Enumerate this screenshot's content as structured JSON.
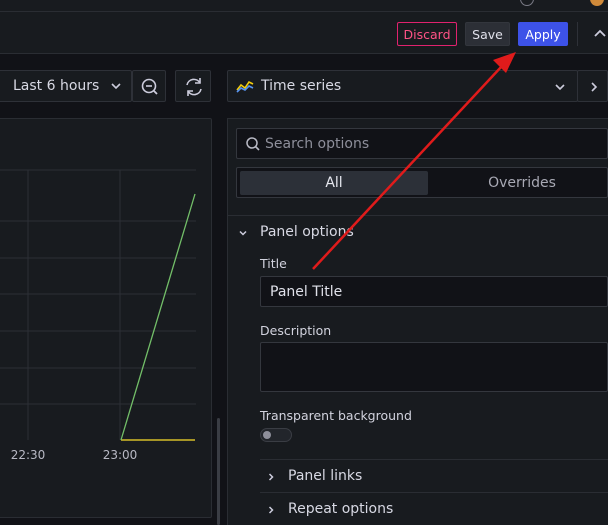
{
  "toolbar": {
    "discard_label": "Discard",
    "save_label": "Save",
    "apply_label": "Apply"
  },
  "time_range": {
    "label": "Last 6 hours"
  },
  "visualization": {
    "selected": "Time series"
  },
  "chart_data": {
    "type": "line",
    "x_tick_labels": [
      "22:30",
      "23:00"
    ],
    "series": [
      {
        "color": "#73bf69",
        "description": "rising line"
      },
      {
        "color": "#fade2a",
        "description": "flat line"
      }
    ]
  },
  "options": {
    "search_placeholder": "Search options",
    "tabs": [
      "All",
      "Overrides"
    ],
    "panel_options": {
      "title": "Panel options",
      "title_label": "Title",
      "title_value": "Panel Title",
      "description_label": "Description",
      "description_value": "",
      "transparent_label": "Transparent background",
      "transparent_on": false
    },
    "collapsed_sections": [
      "Panel links",
      "Repeat options"
    ]
  },
  "colors": {
    "accent": "#3d52e8",
    "discard": "#ff5286",
    "annotation_arrow": "#e01b1b"
  }
}
